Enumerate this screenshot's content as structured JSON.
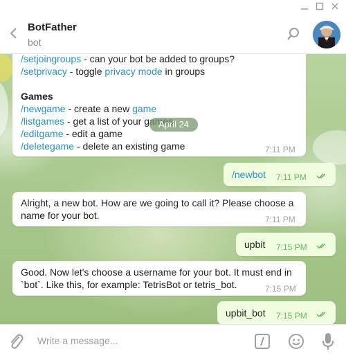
{
  "header": {
    "title": "BotFather",
    "subtitle": "bot"
  },
  "date_pill": "April 24",
  "messages": {
    "first": {
      "line1_cmd": "/setjoingroups",
      "line1_text": " - can your bot be added to groups?",
      "line2_cmd": "/setprivacy",
      "line2_text": " - toggle ",
      "line2_link": "privacy mode",
      "line2_tail": " in groups",
      "section": "Games",
      "g1_cmd": "/newgame",
      "g1_text": " - create a new ",
      "g1_link": "game",
      "g2_cmd": "/listgames",
      "g2_text": " - get a list of your games",
      "g3_cmd": "/editgame",
      "g3_text": " - edit a game",
      "g4_cmd": "/deletegame",
      "g4_text": " - delete an existing game",
      "time": "7:11 PM"
    },
    "m2": {
      "text": "/newbot",
      "time": "7:11 PM"
    },
    "m3": {
      "line1": "Alright, a new bot. How are we going to call it? Please choose a",
      "line2": "name for your bot.",
      "time": "7:11 PM"
    },
    "m4": {
      "text": "upbit",
      "time": "7:15 PM"
    },
    "m5": {
      "line1": "Good. Now let's choose a username for your bot. It must end in",
      "line2": "`bot`. Like this, for example: TetrisBot or tetris_bot.",
      "time": "7:15 PM"
    },
    "m6": {
      "text": "upbit_bot",
      "time": "7:15 PM"
    }
  },
  "composer": {
    "placeholder": "Write a message..."
  },
  "colors": {
    "link": "#2a8fc8",
    "outgoing": "#effdde",
    "check": "#6db566"
  }
}
